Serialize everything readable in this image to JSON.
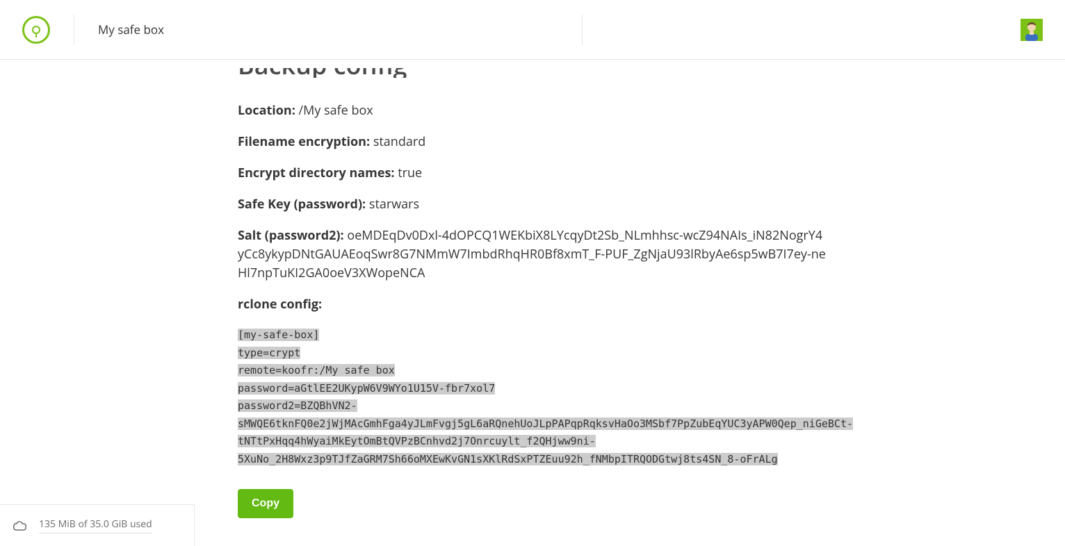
{
  "header": {
    "breadcrumb": "My safe box"
  },
  "page": {
    "title": "Backup config",
    "fields": {
      "location_label": "Location:",
      "location_value": "/My safe box",
      "filename_enc_label": "Filename encryption:",
      "filename_enc_value": "standard",
      "encrypt_dirs_label": "Encrypt directory names:",
      "encrypt_dirs_value": "true",
      "safe_key_label": "Safe Key (password):",
      "safe_key_value": "starwars",
      "salt_label": "Salt (password2):",
      "salt_value": "oeMDEqDv0Dxl-4dOPCQ1WEKbiX8LYcqyDt2Sb_NLmhhsc-wcZ94NAIs_iN82NogrY4yCc8ykypDNtGAUAEoqSwr8G7NMmW7ImbdRhqHR0Bf8xmT_F-PUF_ZgNjaU93lRbyAe6sp5wB7I7ey-neHl7npTuKI2GA0oeV3XWopeNCA",
      "rclone_label": "rclone config:"
    },
    "code": {
      "l1": "[my-safe-box]",
      "l2": "type=crypt",
      "l3": "remote=koofr:/My safe box",
      "l4": "password=aGtlEE2UKypW6V9WYo1U15V-fbr7xol7",
      "l5": "password2=BZQBhVN2-sMWQE6tknFQ0e2jWjMAcGmhFga4yJLmFvgj5gL6aRQnehUoJLpPAPqpRqksvHaOo3MSbf7PpZubEqYUC3yAPW0Qep_niGeBCt-tNTtPxHqq4hWyaiMkEytOmBtQVPzBCnhvd2j7Onrcuylt_f2QHjww9ni-5XuNo_2H8Wxz3p9TJfZaGRM7Sh66oMXEwKvGN1sXKlRdSxPTZEuu92h_fNMbpITRQODGtwj8ts4SN_8-oFrALg"
    },
    "copy_label": "Copy"
  },
  "storage": {
    "text": "135 MiB of 35.0 GiB used"
  },
  "colors": {
    "accent": "#7cc216",
    "button": "#62ba13"
  }
}
